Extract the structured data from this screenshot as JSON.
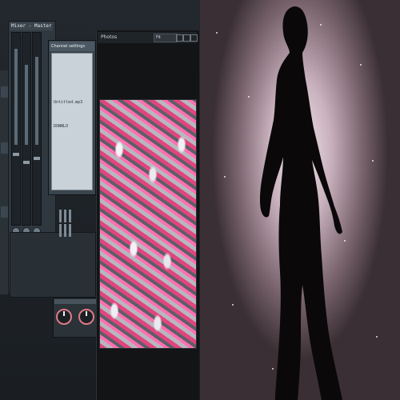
{
  "mixer": {
    "header_label": "Mixer - Master"
  },
  "plugin_window": {
    "title": "Channel settings",
    "lines": [
      "Untitled.mp3",
      "DOWNLO"
    ]
  },
  "viewer": {
    "title": "Photos",
    "zoom_value": "Fit",
    "buttons": [
      "minimize",
      "maximize",
      "close"
    ]
  },
  "icons": {
    "dial_left": "knob-icon",
    "dial_right": "knob-icon"
  },
  "colors": {
    "accent_pink": "#e0457f",
    "dial_ring": "#e07a86",
    "wallpaper_glow": "#efe3ea"
  }
}
